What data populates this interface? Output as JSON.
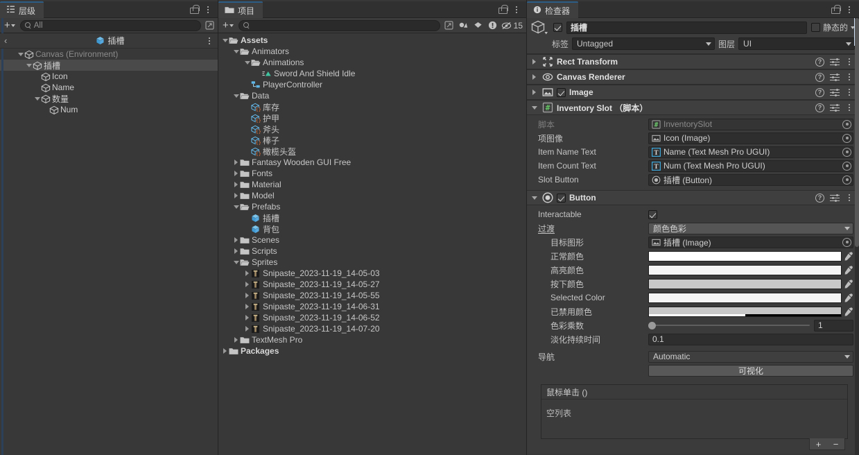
{
  "hierarchy": {
    "tab_label": "层级",
    "tab_icon": "hierarchy-icon",
    "search_placeholder": "All",
    "prefab_title": "插槽",
    "back_glyph": "‹",
    "rows": [
      {
        "label": "Canvas (Environment)",
        "indent": 1,
        "arrow": "down",
        "dim": true,
        "selected": false
      },
      {
        "label": "插槽",
        "indent": 2,
        "arrow": "down",
        "dim": false,
        "selected": true
      },
      {
        "label": "Icon",
        "indent": 3,
        "arrow": "none",
        "dim": false,
        "selected": false
      },
      {
        "label": "Name",
        "indent": 3,
        "arrow": "none",
        "dim": false,
        "selected": false
      },
      {
        "label": "数量",
        "indent": 3,
        "arrow": "down",
        "dim": false,
        "selected": false
      },
      {
        "label": "Num",
        "indent": 4,
        "arrow": "none",
        "dim": false,
        "selected": false
      }
    ]
  },
  "project": {
    "tab_label": "项目",
    "tab_icon": "folder-icon",
    "search_placeholder": "",
    "hidden_count": "15",
    "toolbar_icons": [
      "save-search-icon",
      "filter-by-type-icon",
      "filter-by-label-icon",
      "filter-warning-icon",
      "hidden-items-icon"
    ],
    "rows": [
      {
        "label": "Assets",
        "indent": 0,
        "arrow": "down",
        "icon": "folder-open-icon",
        "bold": true
      },
      {
        "label": "Animators",
        "indent": 1,
        "arrow": "down",
        "icon": "folder-open-icon",
        "bold": false
      },
      {
        "label": "Animations",
        "indent": 2,
        "arrow": "down",
        "icon": "folder-open-icon",
        "bold": false
      },
      {
        "label": "Sword And Shield Idle",
        "indent": 3,
        "arrow": "none",
        "icon": "animation-clip-icon",
        "bold": false
      },
      {
        "label": "PlayerController",
        "indent": 2,
        "arrow": "none",
        "icon": "animator-controller-icon",
        "bold": false
      },
      {
        "label": "Data",
        "indent": 1,
        "arrow": "down",
        "icon": "folder-open-icon",
        "bold": false
      },
      {
        "label": "库存",
        "indent": 2,
        "arrow": "none",
        "icon": "scriptable-object-icon",
        "bold": false
      },
      {
        "label": "护甲",
        "indent": 2,
        "arrow": "none",
        "icon": "scriptable-object-icon",
        "bold": false
      },
      {
        "label": "斧头",
        "indent": 2,
        "arrow": "none",
        "icon": "scriptable-object-icon",
        "bold": false
      },
      {
        "label": "棒子",
        "indent": 2,
        "arrow": "none",
        "icon": "scriptable-object-icon",
        "bold": false
      },
      {
        "label": "橄榄头盔",
        "indent": 2,
        "arrow": "none",
        "icon": "scriptable-object-icon",
        "bold": false
      },
      {
        "label": "Fantasy Wooden GUI  Free",
        "indent": 1,
        "arrow": "right",
        "icon": "folder-icon",
        "bold": false
      },
      {
        "label": "Fonts",
        "indent": 1,
        "arrow": "right",
        "icon": "folder-icon",
        "bold": false
      },
      {
        "label": "Material",
        "indent": 1,
        "arrow": "right",
        "icon": "folder-icon",
        "bold": false
      },
      {
        "label": "Model",
        "indent": 1,
        "arrow": "right",
        "icon": "folder-icon",
        "bold": false
      },
      {
        "label": "Prefabs",
        "indent": 1,
        "arrow": "down",
        "icon": "folder-open-icon",
        "bold": false
      },
      {
        "label": "插槽",
        "indent": 2,
        "arrow": "none",
        "icon": "prefab-icon",
        "bold": false
      },
      {
        "label": "背包",
        "indent": 2,
        "arrow": "none",
        "icon": "prefab-icon",
        "bold": false
      },
      {
        "label": "Scenes",
        "indent": 1,
        "arrow": "right",
        "icon": "folder-icon",
        "bold": false
      },
      {
        "label": "Scripts",
        "indent": 1,
        "arrow": "right",
        "icon": "folder-icon",
        "bold": false
      },
      {
        "label": "Sprites",
        "indent": 1,
        "arrow": "down",
        "icon": "folder-open-icon",
        "bold": false
      },
      {
        "label": "Snipaste_2023-11-19_14-05-03",
        "indent": 2,
        "arrow": "right",
        "icon": "texture-icon",
        "bold": false
      },
      {
        "label": "Snipaste_2023-11-19_14-05-27",
        "indent": 2,
        "arrow": "right",
        "icon": "texture-icon",
        "bold": false
      },
      {
        "label": "Snipaste_2023-11-19_14-05-55",
        "indent": 2,
        "arrow": "right",
        "icon": "texture-icon",
        "bold": false
      },
      {
        "label": "Snipaste_2023-11-19_14-06-31",
        "indent": 2,
        "arrow": "right",
        "icon": "texture-icon",
        "bold": false
      },
      {
        "label": "Snipaste_2023-11-19_14-06-52",
        "indent": 2,
        "arrow": "right",
        "icon": "texture-icon",
        "bold": false
      },
      {
        "label": "Snipaste_2023-11-19_14-07-20",
        "indent": 2,
        "arrow": "right",
        "icon": "texture-icon",
        "bold": false
      },
      {
        "label": "TextMesh Pro",
        "indent": 1,
        "arrow": "right",
        "icon": "folder-icon",
        "bold": false
      },
      {
        "label": "Packages",
        "indent": 0,
        "arrow": "right",
        "icon": "folder-icon",
        "bold": true
      }
    ]
  },
  "inspector": {
    "tab_label": "检查器",
    "tab_icon": "info-icon",
    "object_name": "插槽",
    "object_enabled": true,
    "static_label": "静态的",
    "static_checked": false,
    "tag_label": "标签",
    "tag_value": "Untagged",
    "layer_label": "图层",
    "layer_value": "UI",
    "components": [
      {
        "name": "Rect Transform",
        "icon": "rect-transform-icon",
        "expanded": false,
        "has_enable": false,
        "suffix": ""
      },
      {
        "name": "Canvas Renderer",
        "icon": "canvas-renderer-icon",
        "expanded": false,
        "has_enable": false,
        "suffix": ""
      },
      {
        "name": "Image",
        "icon": "image-icon",
        "expanded": false,
        "has_enable": true,
        "suffix": ""
      },
      {
        "name": "Inventory Slot",
        "icon": "script-icon",
        "expanded": true,
        "has_enable": false,
        "suffix": "（脚本）"
      }
    ],
    "inventory_slot": {
      "fields": [
        {
          "label": "脚本",
          "value": "InventorySlot",
          "icon": "script-icon",
          "disabled": true,
          "indent": false
        },
        {
          "label": "项图像",
          "value": "Icon (Image)",
          "icon": "image-icon",
          "disabled": false,
          "indent": false
        },
        {
          "label": "Item Name Text",
          "value": "Name (Text Mesh Pro UGUI)",
          "icon": "tmp-icon",
          "disabled": false,
          "indent": false
        },
        {
          "label": "Item Count Text",
          "value": "Num (Text Mesh Pro UGUI)",
          "icon": "tmp-icon",
          "disabled": false,
          "indent": false
        },
        {
          "label": "Slot Button",
          "value": "插槽 (Button)",
          "icon": "button-icon",
          "disabled": false,
          "indent": false
        }
      ]
    },
    "button_component": {
      "name": "Button",
      "icon": "button-icon",
      "enabled": true,
      "interactable_label": "Interactable",
      "interactable_checked": true,
      "transition_label": "过渡",
      "transition_value": "颜色色彩",
      "target_graphic_label": "目标图形",
      "target_graphic_value": "插槽 (Image)",
      "target_graphic_icon": "image-icon",
      "colors": [
        {
          "label": "正常颜色",
          "hex": "#ffffff",
          "alpha": 100
        },
        {
          "label": "高亮颜色",
          "hex": "#f5f5f5",
          "alpha": 100
        },
        {
          "label": "按下颜色",
          "hex": "#c8c8c8",
          "alpha": 100
        },
        {
          "label": "Selected Color",
          "hex": "#f5f5f5",
          "alpha": 100
        },
        {
          "label": "已禁用颜色",
          "hex": "#c8c8c8",
          "alpha": 50
        }
      ],
      "color_multiplier_label": "色彩乘数",
      "color_multiplier_value": "1",
      "color_multiplier_pct": 0,
      "fade_duration_label": "淡化持续时间",
      "fade_duration_value": "0.1",
      "navigation_label": "导航",
      "navigation_value": "Automatic",
      "visualize_label": "可视化",
      "event_title": "鼠标单击 ()",
      "event_empty": "空列表",
      "add_glyph": "+",
      "remove_glyph": "−"
    }
  }
}
